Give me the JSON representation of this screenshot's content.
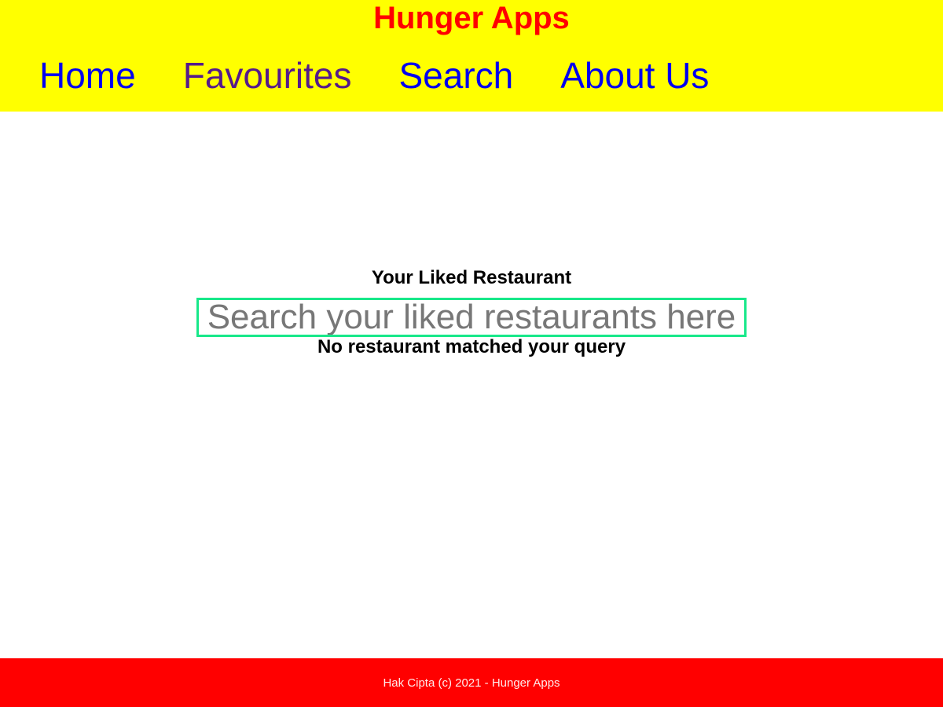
{
  "header": {
    "app_title": "Hunger Apps"
  },
  "nav": {
    "items": [
      {
        "label": "Home",
        "state": "unvisited"
      },
      {
        "label": "Favourites",
        "state": "visited"
      },
      {
        "label": "Search",
        "state": "unvisited"
      },
      {
        "label": "About Us",
        "state": "unvisited"
      }
    ]
  },
  "main": {
    "section_title": "Your Liked Restaurant",
    "search": {
      "value": "",
      "placeholder": "Search your liked restaurants here"
    },
    "empty_message": "No restaurant matched your query"
  },
  "footer": {
    "copyright": "Hak Cipta (c) 2021 - Hunger Apps"
  },
  "colors": {
    "header_background": "#ffff00",
    "title": "#ff0000",
    "link": "#0000ee",
    "visited_link": "#551a8b",
    "search_border": "#18e88a",
    "footer_background": "#ff0000"
  }
}
